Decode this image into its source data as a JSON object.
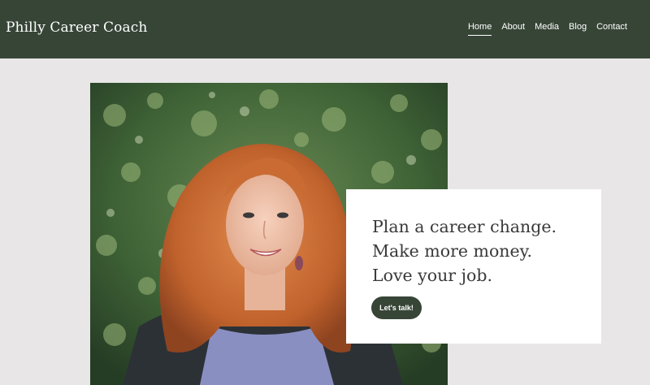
{
  "header": {
    "brand": "Philly Career Coach",
    "nav": [
      {
        "label": "Home",
        "active": true
      },
      {
        "label": "About",
        "active": false
      },
      {
        "label": "Media",
        "active": false
      },
      {
        "label": "Blog",
        "active": false
      },
      {
        "label": "Contact",
        "active": false
      }
    ]
  },
  "hero": {
    "photo_icon": "portrait-photo",
    "tagline": [
      "Plan a career change.",
      "Make more money.",
      "Love your job."
    ],
    "cta_label": "Let's talk!"
  },
  "colors": {
    "header_bg": "#374537",
    "page_bg": "#e8e6e7",
    "card_bg": "#ffffff",
    "button_bg": "#374537"
  }
}
